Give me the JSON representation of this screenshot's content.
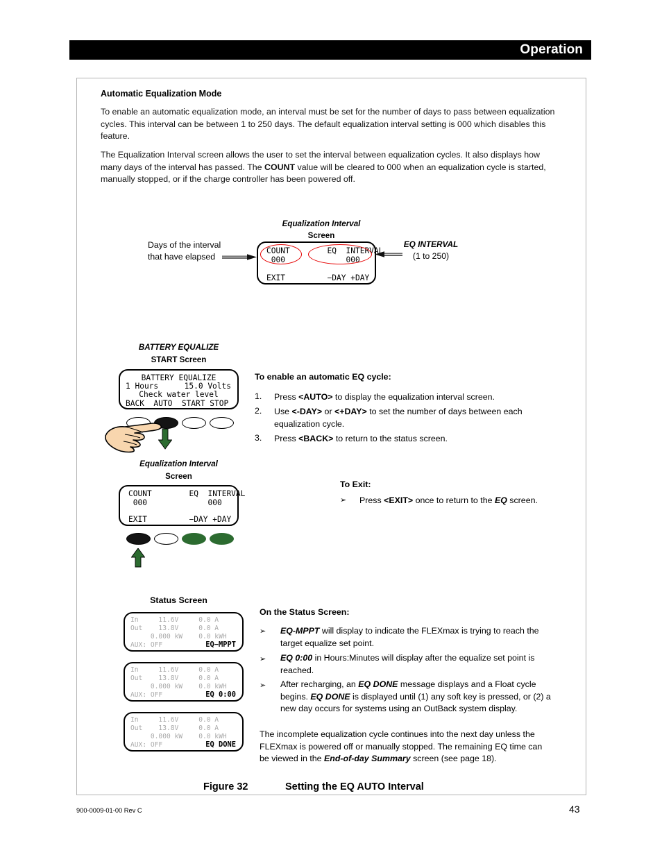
{
  "header": {
    "title": "Operation"
  },
  "section": {
    "heading": "Automatic Equalization Mode",
    "para1": "To enable an automatic equalization mode, an interval must be set for the number of days to pass between equalization cycles.  This  interval can be between 1 to 250 days.  The default equalization interval setting is 000 which  disables this feature.",
    "para2_part1": "The Equalization Interval screen allows the user to set the interval between equalization cycles.  It also displays how many days of the interval has passed.  The ",
    "para2_bold": "COUNT",
    "para2_part2": " value will be cleared to 000 when an equalization cycle  is started, manually stopped, or if the charge controller has been powered off."
  },
  "diagram_top": {
    "screen_label_line1": "Equalization Interval",
    "screen_label_line2": "Screen",
    "annotation_left": "Days of the interval that have elapsed",
    "annotation_right_title": "EQ INTERVAL",
    "annotation_right_sub": "(1 to 250)",
    "lcd": {
      "row1": "COUNT        EQ  INTERVAL",
      "row2": " 000             000",
      "row3": "EXIT         −DAY +DAY"
    }
  },
  "battery_equalize": {
    "label_line1": "BATTERY EQUALIZE",
    "label_line2": "START Screen",
    "lcd": {
      "row1": "BATTERY EQUALIZE",
      "row2": "1 Hours",
      "row2b": "15.0 Volts",
      "row3": "Check water level",
      "row4": "BACK  AUTO  START STOP"
    },
    "buttons": [
      "white",
      "black",
      "white",
      "white"
    ]
  },
  "instructions_enable": {
    "heading": "To enable an automatic EQ cycle:",
    "items": [
      {
        "num": "1.",
        "pre": "Press ",
        "key": "<AUTO>",
        "post": " to display the equalization interval screen."
      },
      {
        "num": "2.",
        "pre": "Use ",
        "key": "<-DAY>",
        "mid": " or ",
        "key2": "<+DAY>",
        "post": " to set the number of days between each equalization cycle."
      },
      {
        "num": "3.",
        "pre": "Press ",
        "key": "<BACK>",
        "post": " to return to the status screen."
      }
    ]
  },
  "diagram_eq_interval": {
    "label_line1": "Equalization Interval",
    "label_line2": "Screen",
    "lcd": {
      "row1": "COUNT        EQ  INTERVAL",
      "row2": " 000             000",
      "row3": "EXIT         −DAY +DAY"
    },
    "buttons": [
      "black",
      "white",
      "green",
      "green"
    ]
  },
  "instructions_exit": {
    "heading": "To Exit:",
    "bullet": "➢",
    "pre": "Press ",
    "key": "<EXIT>",
    "mid": " once to return to the ",
    "emph": "EQ",
    "post": " screen."
  },
  "status_screens": {
    "label": "Status Screen",
    "screens": [
      {
        "row1": "In     11.6V     0.0 A",
        "row2": "Out    13.8V     0.0 A",
        "row3": "     0.000 kW    0.0 kWH",
        "row4": "AUX: OFF",
        "status": "EQ−MPPT"
      },
      {
        "row1": "In     11.6V     0.0 A",
        "row2": "Out    13.8V     0.0 A",
        "row3": "     0.000 kW    0.0 kWH",
        "row4": "AUX: OFF",
        "status": "EQ 0:00"
      },
      {
        "row1": "In     11.6V     0.0 A",
        "row2": "Out    13.8V     0.0 A",
        "row3": "     0.000 kW    0.0 kWH",
        "row4": "AUX: OFF",
        "status": "EQ DONE"
      }
    ]
  },
  "instructions_status": {
    "heading": "On the Status Screen:",
    "bullet": "➢",
    "item1_emph": "EQ-MPPT",
    "item1_text": " will display to indicate the FLEXmax is trying to reach the target equalize set point.",
    "item2_emph": "EQ 0:00",
    "item2_text": " in Hours:Minutes will display after the equalize set point is reached.",
    "item3_pre": "After recharging, an ",
    "item3_emph1": "EQ DONE",
    "item3_mid": " message displays and a Float cycle begins.  ",
    "item3_emph2": "EQ DONE",
    "item3_post": " is displayed until (1) any soft key is pressed, or (2) a new day occurs for systems using an OutBack system display.",
    "closing_pre": "The incomplete equalization cycle continues into the next day unless the FLEXmax is powered off or manually stopped.  The remaining EQ time can be viewed in the ",
    "closing_emph": "End-of-day Summary",
    "closing_post": " screen (see page 18)."
  },
  "figure": {
    "number": "Figure 32",
    "caption": "Setting the EQ AUTO Interval"
  },
  "footer": {
    "doc_id": "900-0009-01-00 Rev C",
    "page": "43"
  },
  "colors": {
    "accent_red": "#e60000",
    "green_button": "#2c6b30",
    "header_bar": "#000000"
  }
}
